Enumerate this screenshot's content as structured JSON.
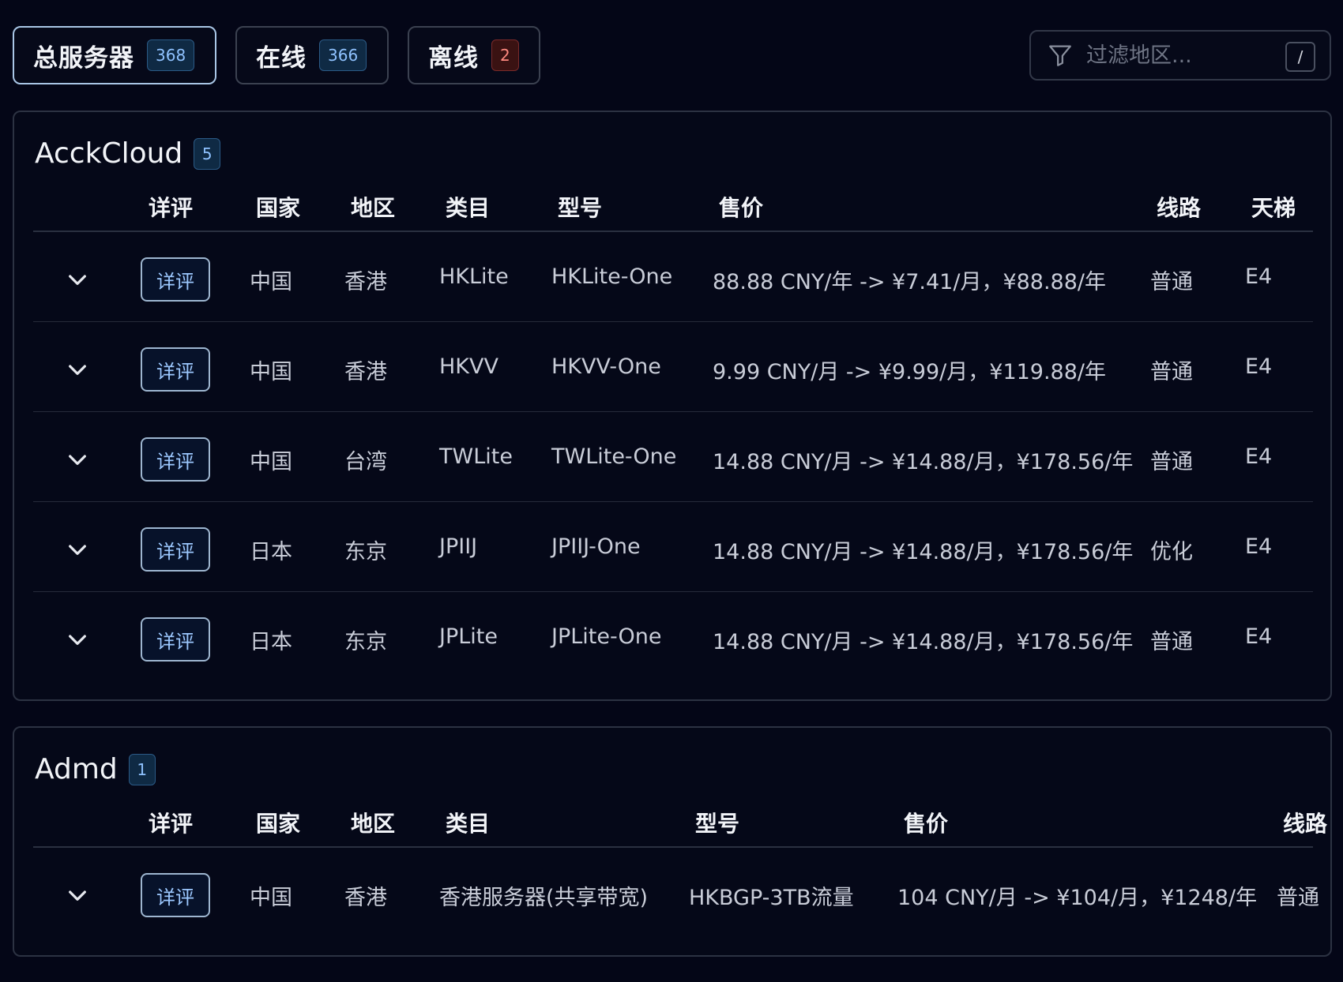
{
  "stats": [
    {
      "label": "总服务器",
      "count": "368",
      "active": true
    },
    {
      "label": "在线",
      "count": "366",
      "active": false
    },
    {
      "label": "离线",
      "count": "2",
      "active": false
    }
  ],
  "filter": {
    "placeholder": "过滤地区...",
    "shortcut": "/"
  },
  "colors": {
    "background": "#040617",
    "accent": "#9cc8ff",
    "offline": "#ff8a80"
  },
  "icons": {
    "filter": "filter-icon",
    "expand": "chevron-down-icon"
  },
  "providers": [
    {
      "name": "AcckCloud",
      "count": "5",
      "columns": [
        "详评",
        "国家",
        "地区",
        "类目",
        "型号",
        "售价",
        "线路",
        "天梯"
      ],
      "rows": [
        {
          "detail": "详评",
          "country": "中国",
          "region": "香港",
          "category": "HKLite",
          "model": "HKLite-One",
          "price": "88.88 CNY/年 -> ¥7.41/月，¥88.88/年",
          "line": "普通",
          "tier": "E4"
        },
        {
          "detail": "详评",
          "country": "中国",
          "region": "香港",
          "category": "HKVV",
          "model": "HKVV-One",
          "price": "9.99 CNY/月 -> ¥9.99/月，¥119.88/年",
          "line": "普通",
          "tier": "E4"
        },
        {
          "detail": "详评",
          "country": "中国",
          "region": "台湾",
          "category": "TWLite",
          "model": "TWLite-One",
          "price": "14.88 CNY/月 -> ¥14.88/月，¥178.56/年",
          "line": "普通",
          "tier": "E4"
        },
        {
          "detail": "详评",
          "country": "日本",
          "region": "东京",
          "category": "JPIIJ",
          "model": "JPIIJ-One",
          "price": "14.88 CNY/月 -> ¥14.88/月，¥178.56/年",
          "line": "优化",
          "tier": "E4"
        },
        {
          "detail": "详评",
          "country": "日本",
          "region": "东京",
          "category": "JPLite",
          "model": "JPLite-One",
          "price": "14.88 CNY/月 -> ¥14.88/月，¥178.56/年",
          "line": "普通",
          "tier": "E4"
        }
      ]
    },
    {
      "name": "Admd",
      "count": "1",
      "columns": [
        "详评",
        "国家",
        "地区",
        "类目",
        "型号",
        "售价",
        "线路"
      ],
      "rows": [
        {
          "detail": "详评",
          "country": "中国",
          "region": "香港",
          "category": "香港服务器(共享带宽)",
          "model": "HKBGP-3TB流量",
          "price": "104 CNY/月 -> ¥104/月，¥1248/年",
          "line": "普通"
        }
      ]
    }
  ]
}
